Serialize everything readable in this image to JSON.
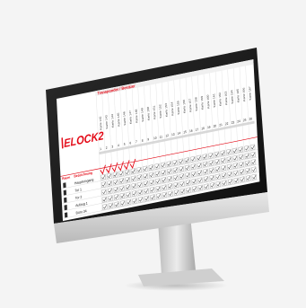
{
  "brand": {
    "logo_text": "ELOCK2",
    "accent_color": "#e30613"
  },
  "grid_header": {
    "title": "Transponder / Besitzer",
    "transponders": [
      "Karte 142",
      "Karte 143",
      "Karte 144",
      "Karte 145",
      "Karte 146",
      "Karte 147",
      "Karte 148",
      "Karte 149",
      "Karte 150",
      "Karte 151",
      "Karte 152",
      "Karte 153",
      "Karte 154",
      "Karte 155",
      "Karte 156",
      "Karte 157",
      "Karte 158",
      "Karte 159",
      "Karte 160",
      "Karte 161",
      "Karte 162",
      "Karte 163",
      "Karte 164",
      "Karte 165",
      "Karte 166",
      "Karte 167"
    ],
    "numbers": [
      "1",
      "2",
      "3",
      "4",
      "5",
      "6",
      "7",
      "8",
      "9",
      "10",
      "11",
      "12",
      "13",
      "14",
      "15",
      "16",
      "17",
      "18",
      "19",
      "20",
      "21",
      "22",
      "23",
      "24",
      "25",
      "26"
    ]
  },
  "table": {
    "columns": {
      "room": "Raum",
      "description": "Bezeichnung"
    },
    "rows": [
      {
        "icon": "door-icon",
        "label": "Haupteingang"
      },
      {
        "icon": "door-icon",
        "label": "Tor 1"
      },
      {
        "icon": "door-icon",
        "label": "Tor 2"
      },
      {
        "icon": "door-icon",
        "label": "Aufzug 1"
      },
      {
        "icon": "door-icon",
        "label": "Büro 34"
      }
    ]
  }
}
